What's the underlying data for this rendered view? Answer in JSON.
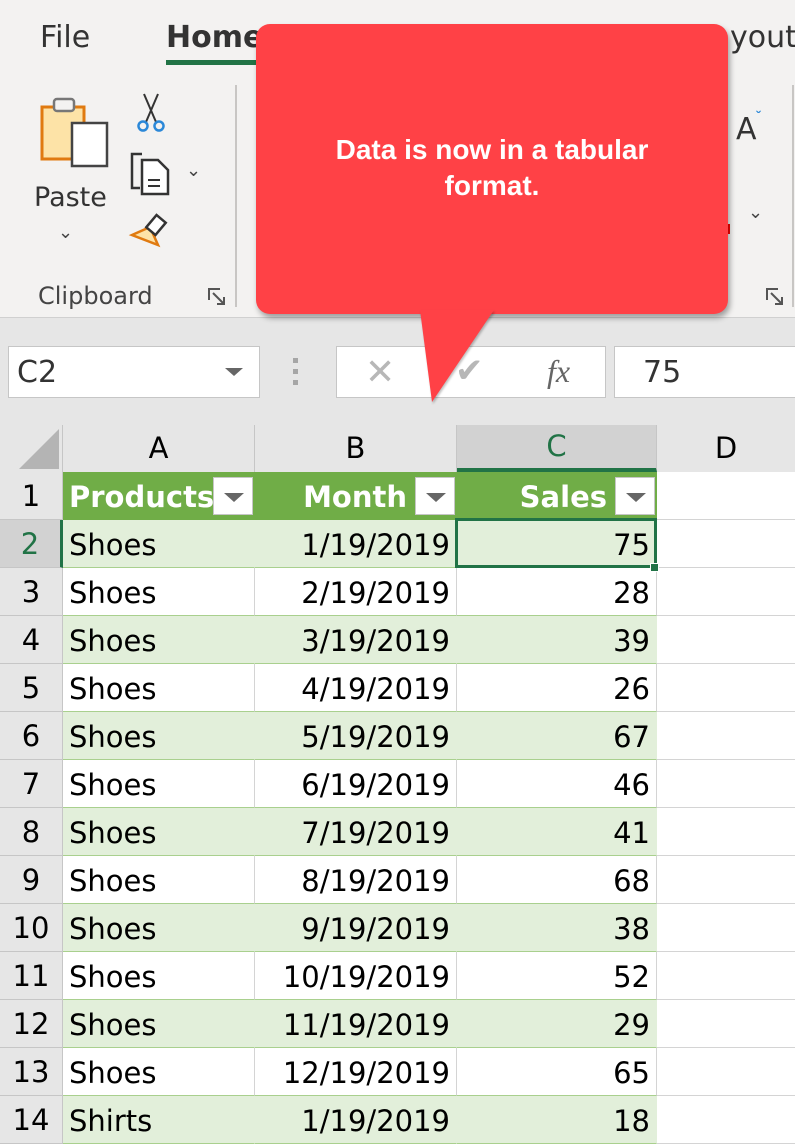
{
  "ribbon": {
    "tabs": [
      {
        "label": "File"
      },
      {
        "label": "Home",
        "active": true
      },
      {
        "label": "yout"
      }
    ],
    "clipboard_group": {
      "label": "Clipboard",
      "paste_label": "Paste"
    },
    "font_size_glyph": "A"
  },
  "formula_bar": {
    "name_box": "C2",
    "fx_label": "fx",
    "cancel_glyph": "✕",
    "enter_glyph": "✔",
    "formula_value": "75"
  },
  "callout": {
    "text": "Data is now in a tabular format.",
    "color": "#ff4146"
  },
  "sheet": {
    "columns": [
      "A",
      "B",
      "C",
      "D"
    ],
    "selected_column": "C",
    "selected_row": 2,
    "active_cell": "C2",
    "table_header": [
      "Products",
      "Month",
      "Sales"
    ],
    "header_color": "#70ad47",
    "band_color": "#e2efda",
    "rows": [
      {
        "num": "1"
      },
      {
        "num": "2",
        "product": "Shoes",
        "month": "1/19/2019",
        "sales": "75"
      },
      {
        "num": "3",
        "product": "Shoes",
        "month": "2/19/2019",
        "sales": "28"
      },
      {
        "num": "4",
        "product": "Shoes",
        "month": "3/19/2019",
        "sales": "39"
      },
      {
        "num": "5",
        "product": "Shoes",
        "month": "4/19/2019",
        "sales": "26"
      },
      {
        "num": "6",
        "product": "Shoes",
        "month": "5/19/2019",
        "sales": "67"
      },
      {
        "num": "7",
        "product": "Shoes",
        "month": "6/19/2019",
        "sales": "46"
      },
      {
        "num": "8",
        "product": "Shoes",
        "month": "7/19/2019",
        "sales": "41"
      },
      {
        "num": "9",
        "product": "Shoes",
        "month": "8/19/2019",
        "sales": "68"
      },
      {
        "num": "10",
        "product": "Shoes",
        "month": "9/19/2019",
        "sales": "38"
      },
      {
        "num": "11",
        "product": "Shoes",
        "month": "10/19/2019",
        "sales": "52"
      },
      {
        "num": "12",
        "product": "Shoes",
        "month": "11/19/2019",
        "sales": "29"
      },
      {
        "num": "13",
        "product": "Shoes",
        "month": "12/19/2019",
        "sales": "65"
      },
      {
        "num": "14",
        "product": "Shirts",
        "month": "1/19/2019",
        "sales": "18"
      }
    ]
  }
}
